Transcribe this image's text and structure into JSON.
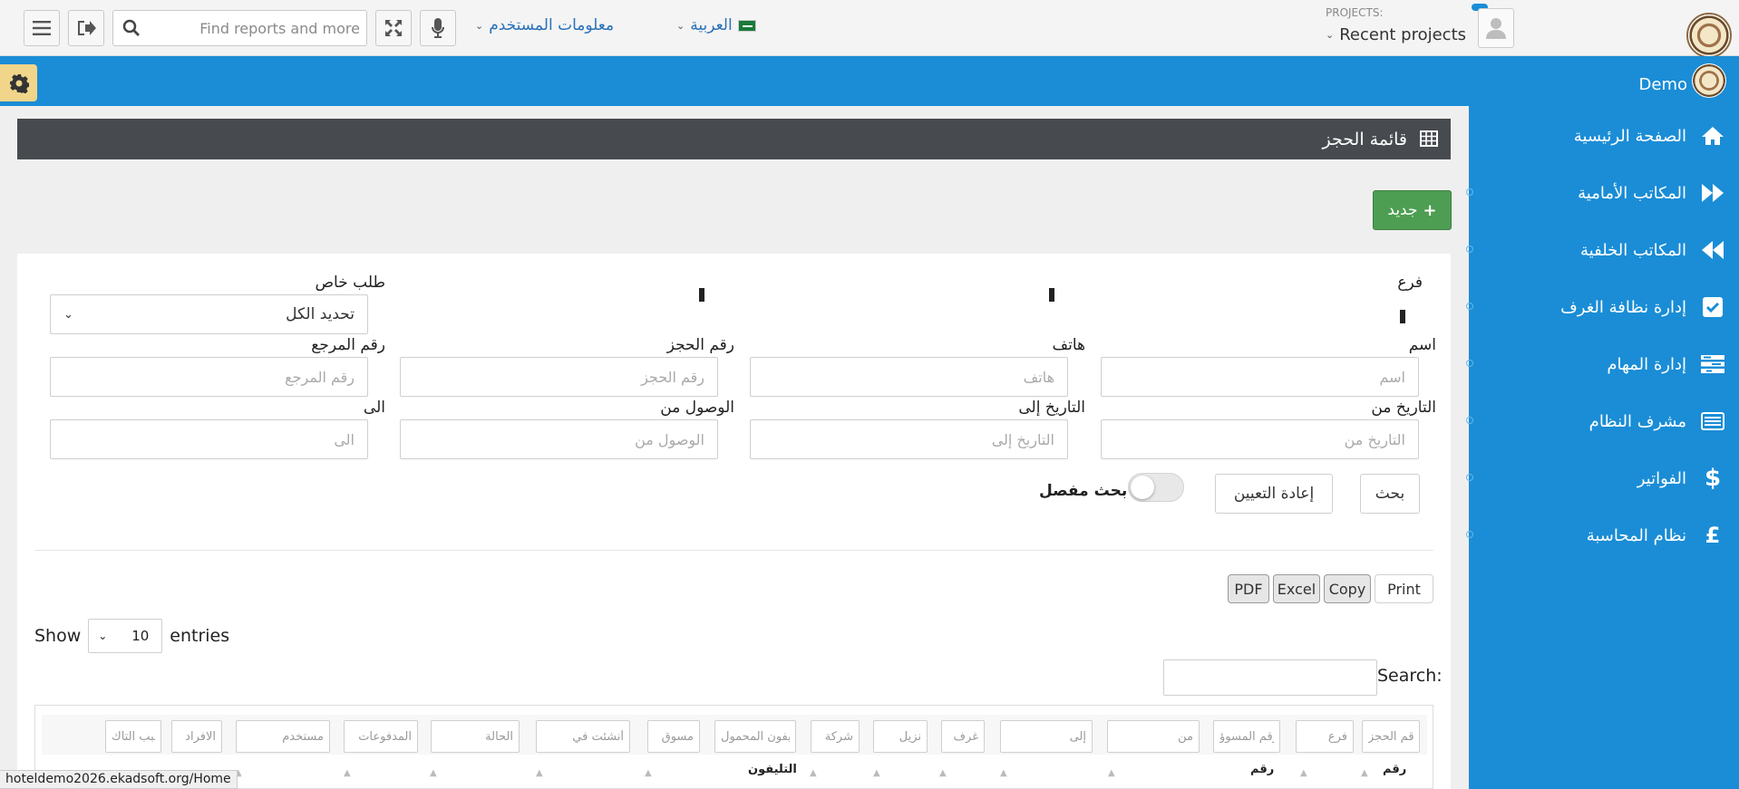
{
  "topbar": {
    "search_placeholder": "Find reports and more",
    "user_info": "معلومات المستخدم",
    "language": "العربية",
    "projects_label": "PROJECTS:",
    "projects_link": "Recent projects"
  },
  "sidebar": {
    "user_name": "Demo",
    "items": [
      {
        "label": "الصفحة الرئيسية",
        "icon": "home-icon"
      },
      {
        "label": "المكاتب الأمامية",
        "icon": "fast-forward-icon"
      },
      {
        "label": "المكاتب الخلفية",
        "icon": "fast-backward-icon"
      },
      {
        "label": "إدارة نظافة الغرف",
        "icon": "checkbox-icon"
      },
      {
        "label": "إدارة المهام",
        "icon": "tasks-icon"
      },
      {
        "label": "مشرف النظام",
        "icon": "id-card-icon"
      },
      {
        "label": "الفواتير",
        "icon": "dollar-icon"
      },
      {
        "label": "نظام المحاسبة",
        "icon": "pound-icon"
      }
    ]
  },
  "page": {
    "title": "قائمة الحجز",
    "new_button": "جديد"
  },
  "form": {
    "branch_label": "فرع",
    "special_request_label": "طلب خاص",
    "special_request_value": "تحديد الكل",
    "name_label": "اسم",
    "name_placeholder": "اسم",
    "phone_label": "هاتف",
    "phone_placeholder": "هاتف",
    "booking_no_label": "رقم الحجز",
    "booking_no_placeholder": "رقم الحجز",
    "ref_no_label": "رقم المرجع",
    "ref_no_placeholder": "رقم المرجع",
    "date_from_label": "التاريخ من",
    "date_from_placeholder": "التاريخ من",
    "date_to_label": "التاريخ إلى",
    "date_to_placeholder": "التاريخ إلى",
    "arrival_from_label": "الوصول من",
    "arrival_from_placeholder": "الوصول من",
    "to_label": "الى",
    "to_placeholder": "الى",
    "search_button": "بحث",
    "reset_button": "إعادة التعيين",
    "advanced_search_label": "بحث مفصل"
  },
  "datatable": {
    "export_buttons": {
      "print": "Print",
      "copy": "Copy",
      "excel": "Excel",
      "pdf": "PDF"
    },
    "show_label": "Show",
    "entries_value": "10",
    "entries_label": "entries",
    "search_label": "Search:",
    "filter_placeholders": [
      "رقم الحجز",
      "فرع",
      "رقم المسوؤ",
      "من",
      "إلى",
      "غرف",
      "نزيل",
      "شركة",
      "التليفون المحمول",
      "مسوق",
      "أنشئت في",
      "الحالة",
      "المدفوعات",
      "مستخدم",
      "الافراد",
      "سبب التأك"
    ],
    "visible_headers": [
      "رقم",
      "رقم",
      "التليفون"
    ]
  },
  "statusbar": {
    "url": "hoteldemo2026.ekadsoft.org/Home"
  },
  "colors": {
    "primary_blue": "#1a8dd6",
    "title_bar": "#474b4f",
    "new_button_green": "#4d9e52",
    "settings_yellow": "#f0d58a",
    "link_blue": "#2a71b8"
  }
}
